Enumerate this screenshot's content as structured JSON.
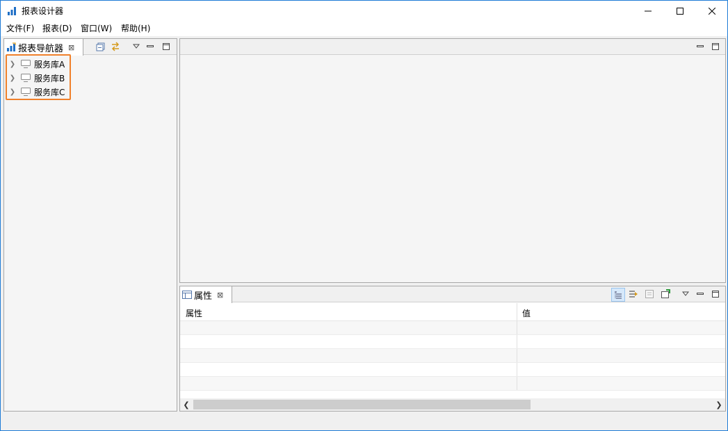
{
  "window": {
    "title": "报表设计器",
    "accent": "#1e7bd6"
  },
  "menu": [
    {
      "label": "文件(F)"
    },
    {
      "label": "报表(D)"
    },
    {
      "label": "窗口(W)"
    },
    {
      "label": "帮助(H)"
    }
  ],
  "navigator": {
    "tab_label": "报表导航器",
    "close_glyph": "⊠",
    "items": [
      {
        "label": "服务库A",
        "icon": "server-icon"
      },
      {
        "label": "服务库B",
        "icon": "server-icon"
      },
      {
        "label": "服务库C",
        "icon": "server-icon"
      }
    ],
    "highlight_color": "#f0802a"
  },
  "properties": {
    "tab_label": "属性",
    "close_glyph": "⊠",
    "columns": [
      "属性",
      "值"
    ]
  }
}
